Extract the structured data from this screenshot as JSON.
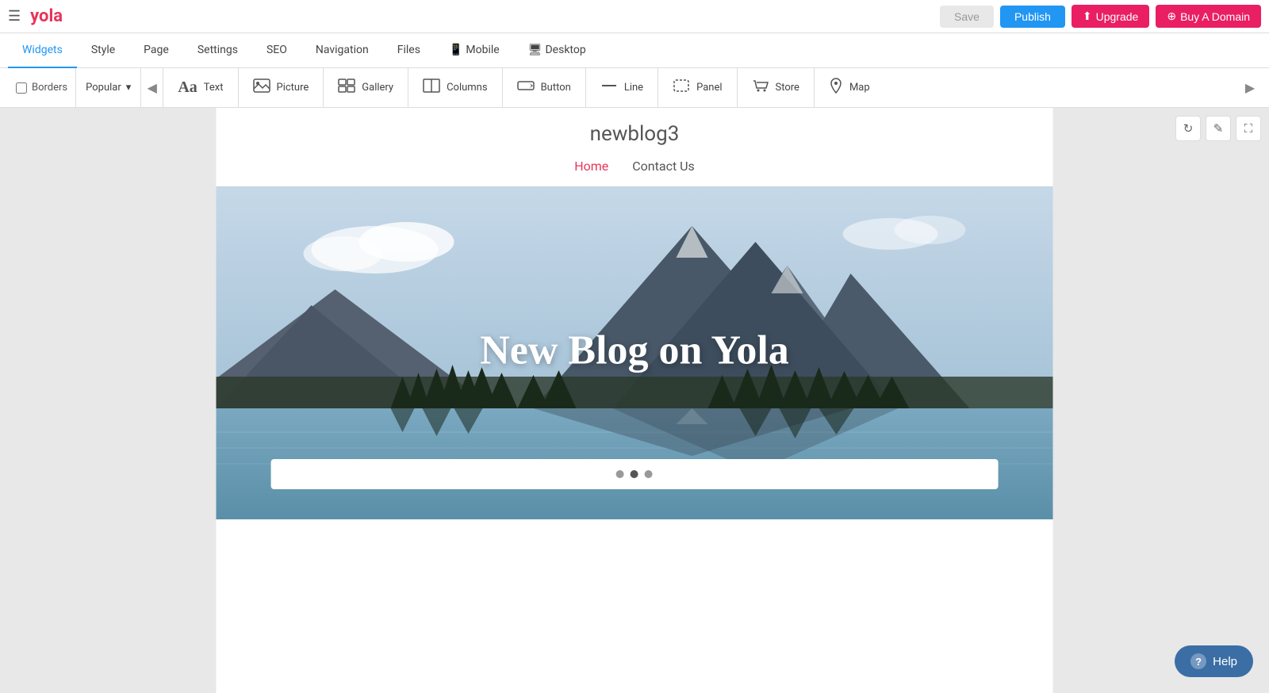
{
  "topbar": {
    "logo": "yola",
    "hamburger_label": "☰",
    "save_label": "Save",
    "publish_label": "Publish",
    "upgrade_label": "Upgrade",
    "upgrade_icon": "⬆",
    "domain_label": "Buy A Domain",
    "domain_icon": "⊕"
  },
  "navtabs": {
    "tabs": [
      {
        "id": "widgets",
        "label": "Widgets",
        "active": true
      },
      {
        "id": "style",
        "label": "Style",
        "active": false
      },
      {
        "id": "page",
        "label": "Page",
        "active": false
      },
      {
        "id": "settings",
        "label": "Settings",
        "active": false
      },
      {
        "id": "seo",
        "label": "SEO",
        "active": false
      },
      {
        "id": "navigation",
        "label": "Navigation",
        "active": false
      },
      {
        "id": "files",
        "label": "Files",
        "active": false
      },
      {
        "id": "mobile",
        "label": "Mobile",
        "active": false
      },
      {
        "id": "desktop",
        "label": "Desktop",
        "active": false
      }
    ]
  },
  "widget_toolbar": {
    "borders_label": "Borders",
    "popular_label": "Popular",
    "prev_arrow": "◀",
    "next_arrow": "▶",
    "items": [
      {
        "id": "text",
        "label": "Text",
        "icon": "Aa"
      },
      {
        "id": "picture",
        "label": "Picture",
        "icon": "🖼"
      },
      {
        "id": "gallery",
        "label": "Gallery",
        "icon": "⊞"
      },
      {
        "id": "columns",
        "label": "Columns",
        "icon": "⊟"
      },
      {
        "id": "button",
        "label": "Button",
        "icon": "▷"
      },
      {
        "id": "line",
        "label": "Line",
        "icon": "—"
      },
      {
        "id": "panel",
        "label": "Panel",
        "icon": "⬚"
      },
      {
        "id": "store",
        "label": "Store",
        "icon": "🛒"
      },
      {
        "id": "map",
        "label": "Map",
        "icon": "📍"
      }
    ]
  },
  "canvas_controls": {
    "refresh_icon": "↻",
    "edit_icon": "✎",
    "expand_icon": "⛶"
  },
  "site": {
    "title": "newblog3",
    "nav_links": [
      {
        "label": "Home",
        "active": true
      },
      {
        "label": "Contact Us",
        "active": false
      }
    ],
    "hero_text": "New Blog on Yola",
    "slider_dots": 3
  },
  "help": {
    "label": "Help",
    "icon": "?"
  }
}
